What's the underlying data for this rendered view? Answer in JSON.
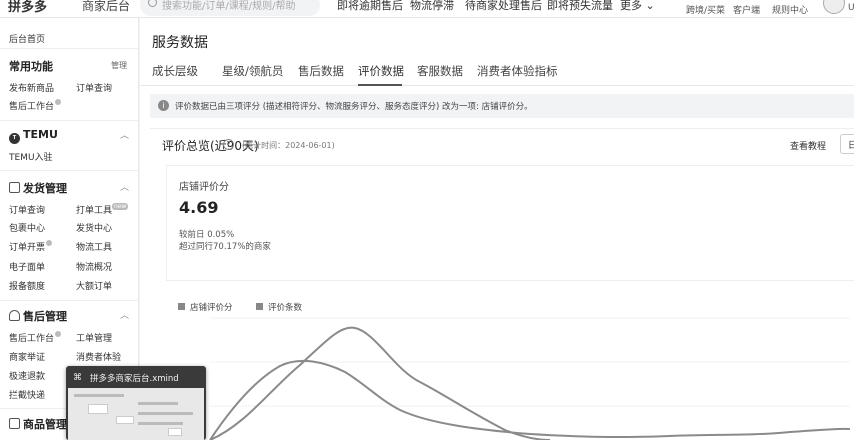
{
  "topbar": {
    "logo": "拼多多",
    "logo_sub": "商家后台",
    "search_placeholder": "搜索功能/订单/课程/规则/帮助",
    "nav": [
      "即将逾期售后",
      "物流停滞",
      "待商家处理售后",
      "即将预失流量",
      "更多"
    ],
    "links": [
      "跨境/买菜",
      "客户端",
      "规则中心"
    ],
    "avatar_letter": "U"
  },
  "sidebar": {
    "home": "后台首页",
    "common_title": "常用功能",
    "common_manage": "管理",
    "common_items": [
      "发布新商品",
      "订单查询",
      "售后工作台"
    ],
    "temu_title": "TEMU",
    "temu_items": [
      "TEMU入驻"
    ],
    "shipping_title": "发货管理",
    "shipping_items": [
      "订单查询",
      "打单工具",
      "包裹中心",
      "发货中心",
      "订单开票",
      "物流工具",
      "电子面单",
      "物流概况",
      "报备额度",
      "大额订单"
    ],
    "shipping_badge": "new",
    "after_title": "售后管理",
    "after_items": [
      "售后工作台",
      "工单管理",
      "商家举证",
      "消费者体验",
      "极速退款",
      "拦截快递"
    ],
    "goods_title": "商品管理"
  },
  "main": {
    "title": "服务数据",
    "tabs": [
      "成长层级",
      "星级/领航员",
      "售后数据",
      "评价数据",
      "客服数据",
      "消费者体验指标"
    ],
    "active_tab": "评价数据",
    "notice": "评价数据已由三项评分 (描述相符评分、物流服务评分、服务态度评分) 改为一项: 店铺评价分。",
    "card": {
      "title": "评价总览(近90天)",
      "help": "?",
      "stat_time": "(统计时间：2024-06-01)",
      "tutorial": "查看教程",
      "tutorial_btn": "日",
      "metric_label": "店铺评价分",
      "metric_value": "4.69",
      "metric_sub1": "较前日  0.05%",
      "metric_sub2": "超过同行70.17%的商家",
      "legend": [
        "店铺评价分",
        "评价条数"
      ]
    }
  },
  "floating_window": {
    "icon": "⌘",
    "title": "拼多多商家后台.xmind"
  },
  "colors": {
    "line": "#8a8a8a",
    "accent": "#555555"
  }
}
